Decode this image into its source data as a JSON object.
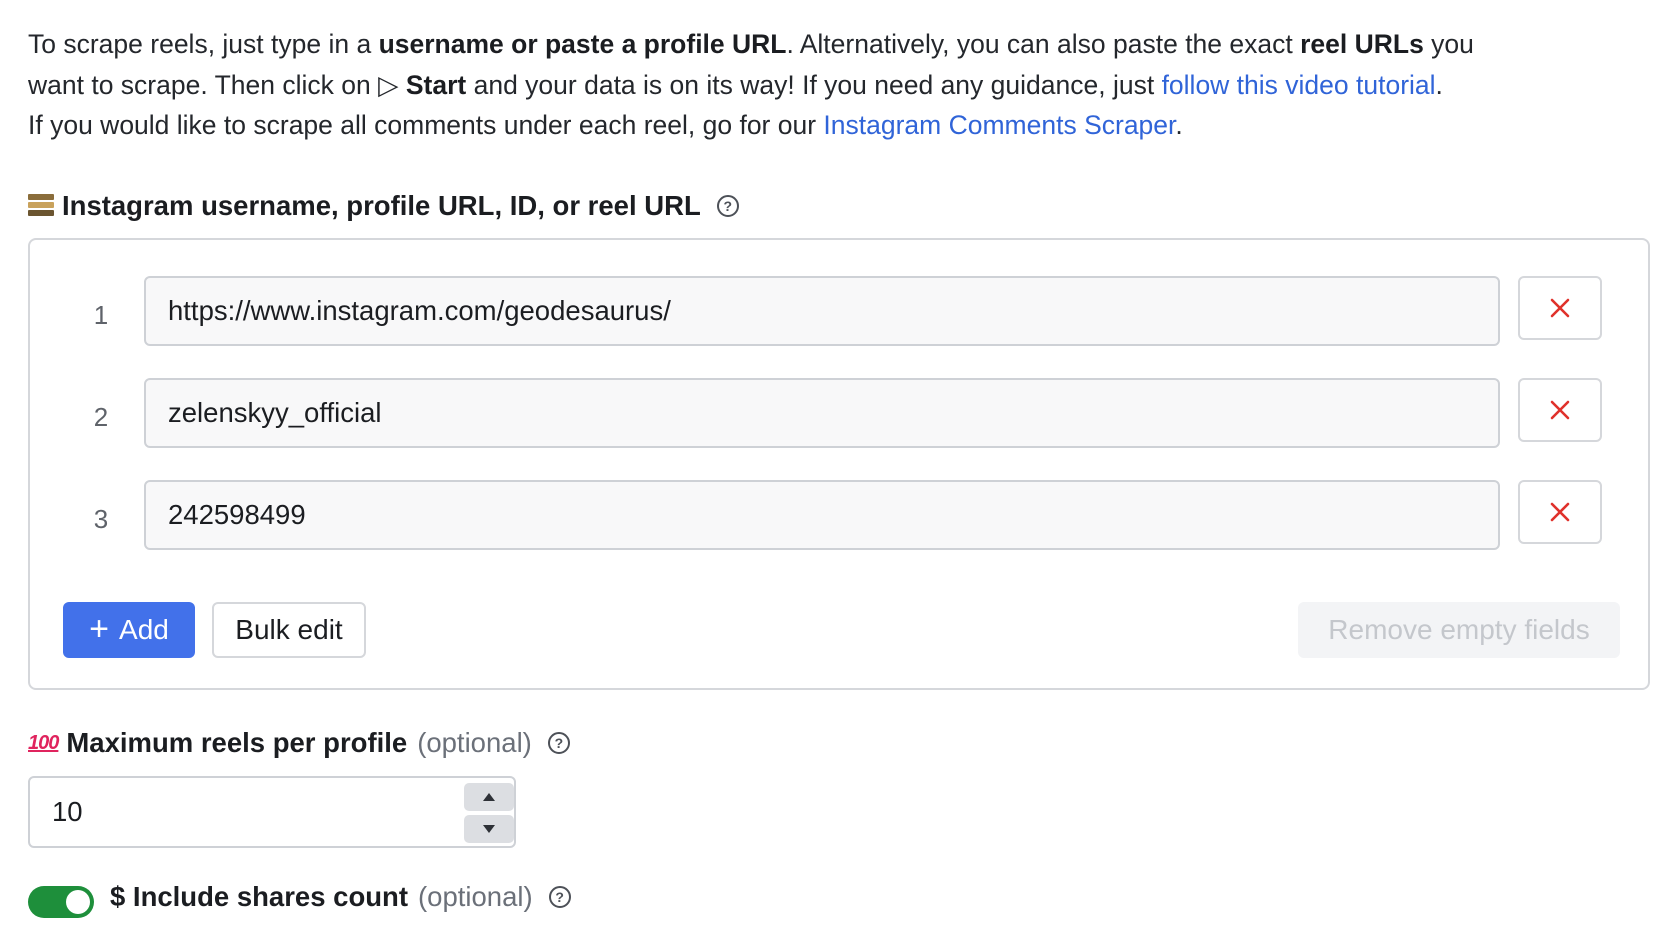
{
  "intro": {
    "l1_a": "To scrape reels, just type in a ",
    "l1_b": "username or paste a profile URL",
    "l1_c": ". Alternatively, you can also paste the exact ",
    "l1_d": "reel URLs",
    "l1_e": " you",
    "l2_a": "want to scrape. Then click on ",
    "l2_icon": "▷",
    "l2_b": "Start",
    "l2_c": " and your data is on its way! If you need any guidance, just ",
    "l2_link": "follow this video tutorial",
    "l2_d": ".",
    "l3_a": "If you would like to scrape all comments under each reel, go for our ",
    "l3_link": "Instagram Comments Scraper",
    "l3_b": "."
  },
  "input_field": {
    "icon": "film-frames-icon",
    "label": "Instagram username, profile URL, ID, or reel URL",
    "help": "?",
    "rows": [
      {
        "num": "1",
        "value": "https://www.instagram.com/geodesaurus/"
      },
      {
        "num": "2",
        "value": "zelenskyy_official"
      },
      {
        "num": "3",
        "value": "242598499"
      }
    ],
    "add_icon": "+",
    "add_label": "Add",
    "bulk_label": "Bulk edit",
    "remove_empty_label": "Remove empty fields"
  },
  "max_reels": {
    "icon": "hundred-points-icon",
    "icon_text": "100",
    "label": "Maximum reels per profile",
    "optional": "(optional)",
    "help": "?",
    "value": "10"
  },
  "shares": {
    "toggle_on": true,
    "label": "$ Include shares count",
    "optional": "(optional)",
    "help": "?"
  },
  "colors": {
    "link": "#3064d8",
    "primary_button": "#4271ea",
    "delete_icon": "#e0312b",
    "toggle_on": "#1e8f3b"
  }
}
